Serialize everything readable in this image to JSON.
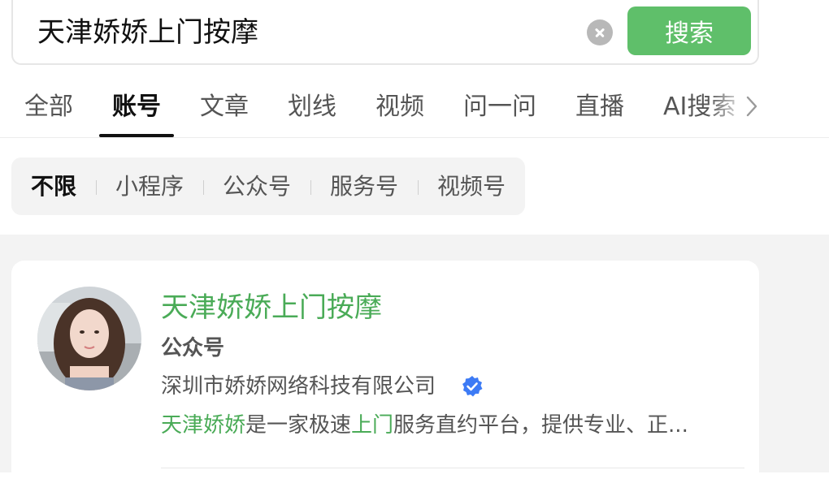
{
  "search": {
    "query": "天津娇娇上门按摩",
    "button_label": "搜索",
    "clear_icon": "clear-circle-icon"
  },
  "tabs": {
    "items": [
      {
        "label": "全部"
      },
      {
        "label": "账号",
        "active": true
      },
      {
        "label": "文章"
      },
      {
        "label": "划线"
      },
      {
        "label": "视频"
      },
      {
        "label": "问一问"
      },
      {
        "label": "直播"
      },
      {
        "label": "AI搜索"
      }
    ],
    "more_icon": "chevron-right-icon"
  },
  "filters": {
    "items": [
      {
        "label": "不限",
        "active": true
      },
      {
        "label": "小程序"
      },
      {
        "label": "公众号"
      },
      {
        "label": "服务号"
      },
      {
        "label": "视频号"
      }
    ]
  },
  "result": {
    "name": "天津娇娇上门按摩",
    "type": "公众号",
    "org": "深圳市娇娇网络科技有限公司",
    "verified_icon": "verified-badge-icon",
    "desc": {
      "hl1": "天津娇娇",
      "t1": "是一家极速",
      "hl2": "上门",
      "t2": "服务直约平台，提供专业、正..."
    }
  },
  "colors": {
    "accent_green": "#5fbf6a",
    "highlight_green": "#4aab57",
    "verify_blue": "#3d7bf5"
  }
}
